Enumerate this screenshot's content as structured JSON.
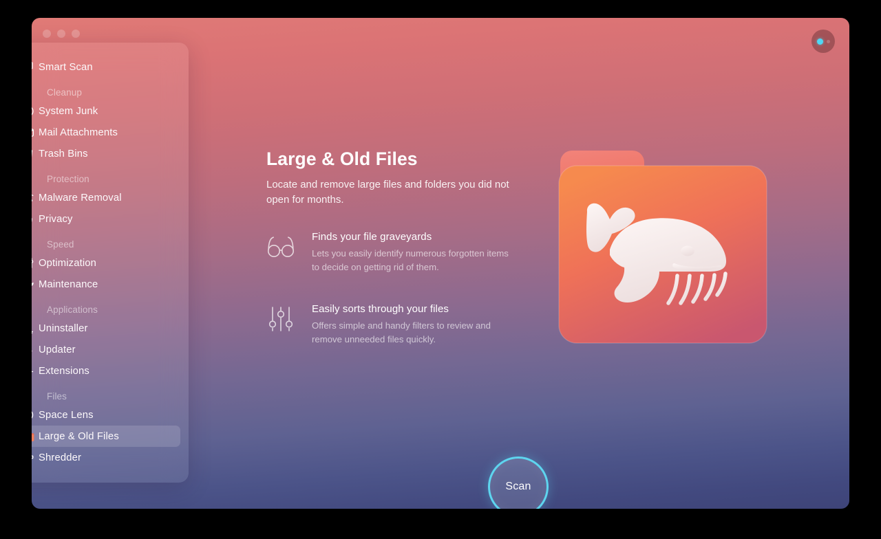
{
  "window": {
    "traffic_lights": [
      "close",
      "minimize",
      "maximize"
    ],
    "status_orb": {
      "name": "status-indicator",
      "active_color": "#4fd8f5"
    }
  },
  "sidebar": {
    "groups": [
      {
        "label": "",
        "items": [
          {
            "label": "Smart Scan",
            "icon": "smart-scan-icon",
            "selected": false
          }
        ]
      },
      {
        "label": "Cleanup",
        "items": [
          {
            "label": "System Junk",
            "icon": "system-junk-icon",
            "selected": false
          },
          {
            "label": "Mail Attachments",
            "icon": "mail-icon",
            "selected": false
          },
          {
            "label": "Trash Bins",
            "icon": "trash-bin-icon",
            "selected": false
          }
        ]
      },
      {
        "label": "Protection",
        "items": [
          {
            "label": "Malware Removal",
            "icon": "biohazard-icon",
            "selected": false
          },
          {
            "label": "Privacy",
            "icon": "hand-icon",
            "selected": false
          }
        ]
      },
      {
        "label": "Speed",
        "items": [
          {
            "label": "Optimization",
            "icon": "sliders-icon",
            "selected": false
          },
          {
            "label": "Maintenance",
            "icon": "wrench-icon",
            "selected": false
          }
        ]
      },
      {
        "label": "Applications",
        "items": [
          {
            "label": "Uninstaller",
            "icon": "uninstaller-icon",
            "selected": false
          },
          {
            "label": "Updater",
            "icon": "updater-arrow-icon",
            "selected": false
          },
          {
            "label": "Extensions",
            "icon": "puzzle-piece-icon",
            "selected": false
          }
        ]
      },
      {
        "label": "Files",
        "items": [
          {
            "label": "Space Lens",
            "icon": "space-lens-icon",
            "selected": false
          },
          {
            "label": "Large & Old Files",
            "icon": "orange-folder-icon",
            "selected": true
          },
          {
            "label": "Shredder",
            "icon": "shredder-icon",
            "selected": false
          }
        ]
      }
    ]
  },
  "main": {
    "title": "Large & Old Files",
    "subtitle": "Locate and remove large files and folders you did not open for months.",
    "features": [
      {
        "icon": "glasses-icon",
        "title": "Finds your file graveyards",
        "description": "Lets you easily identify numerous forgotten items to decide on getting rid of them."
      },
      {
        "icon": "sliders-filter-icon",
        "title": "Easily sorts through your files",
        "description": "Offers simple and handy filters to review and remove unneeded files quickly."
      }
    ],
    "illustration": "whale-folder-illustration",
    "scan_button_label": "Scan"
  },
  "colors": {
    "gradient_top": "#e07a76",
    "gradient_mid": "#8e6a8f",
    "gradient_bottom": "#3e4478",
    "accent_cyan": "#5ed5ef",
    "folder_orange": "#f07a4e"
  }
}
